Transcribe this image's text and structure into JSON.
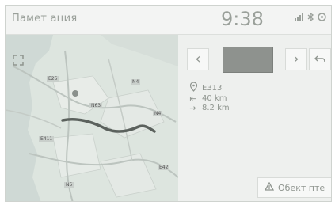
{
  "header": {
    "app_title": "Памет ация",
    "clock": "9:38"
  },
  "icons": {
    "signal": "signal-icon",
    "bluetooth": "bluetooth-icon",
    "settings": "settings-icon",
    "expand": "expand-icon",
    "prev": "chevron-left-icon",
    "next": "chevron-right-icon",
    "back": "back-icon",
    "pin": "location-pin-icon",
    "warning": "warning-icon"
  },
  "route_panel": {
    "road_label": "E313",
    "distance_1": "40 km",
    "distance_2": "8.2 km",
    "report_button": "Обект пте"
  },
  "map": {
    "road_labels": [
      "E25",
      "N4",
      "N63",
      "E411",
      "N4",
      "N5",
      "E42"
    ]
  }
}
